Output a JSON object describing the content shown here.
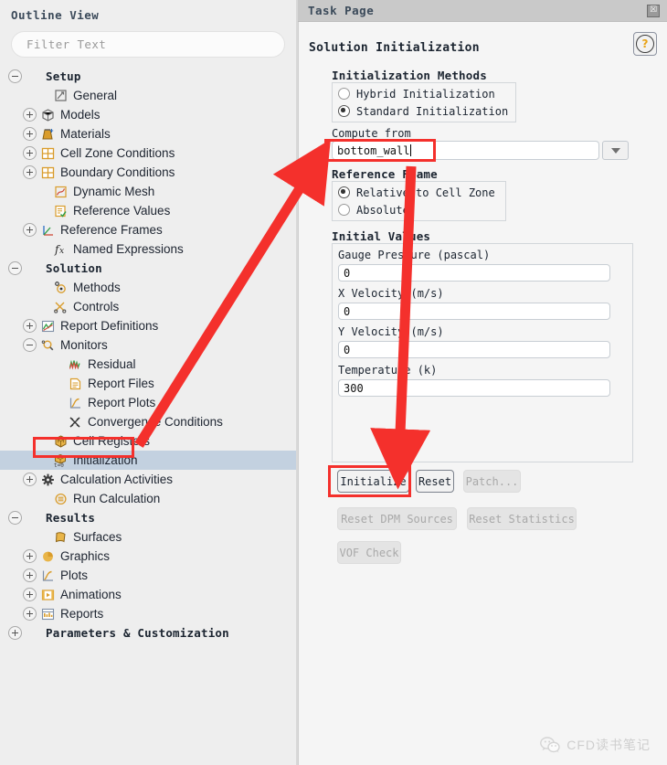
{
  "outline": {
    "title": "Outline View",
    "filter": {
      "placeholder": "Filter Text",
      "value": ""
    },
    "items": [
      {
        "label": "Setup",
        "icon": "none-icon",
        "exp": "minus",
        "level": 0,
        "group": true,
        "selected": false
      },
      {
        "label": "General",
        "icon": "general-icon",
        "exp": "none",
        "level": 2,
        "group": false,
        "selected": false
      },
      {
        "label": "Models",
        "icon": "models-cube-icon",
        "exp": "plus",
        "level": 1,
        "group": false,
        "selected": false
      },
      {
        "label": "Materials",
        "icon": "materials-flask-icon",
        "exp": "plus",
        "level": 1,
        "group": false,
        "selected": false
      },
      {
        "label": "Cell Zone Conditions",
        "icon": "grid-icon",
        "exp": "plus",
        "level": 1,
        "group": false,
        "selected": false
      },
      {
        "label": "Boundary Conditions",
        "icon": "grid-icon",
        "exp": "plus",
        "level": 1,
        "group": false,
        "selected": false
      },
      {
        "label": "Dynamic Mesh",
        "icon": "dynamic-mesh-icon",
        "exp": "none",
        "level": 2,
        "group": false,
        "selected": false
      },
      {
        "label": "Reference Values",
        "icon": "clipboard-icon",
        "exp": "none",
        "level": 2,
        "group": false,
        "selected": false
      },
      {
        "label": "Reference Frames",
        "icon": "axes-icon",
        "exp": "plus",
        "level": 1,
        "group": false,
        "selected": false
      },
      {
        "label": "Named Expressions",
        "icon": "function-icon",
        "exp": "none",
        "level": 2,
        "group": false,
        "selected": false
      },
      {
        "label": "Solution",
        "icon": "none-icon",
        "exp": "minus",
        "level": 0,
        "group": true,
        "selected": false
      },
      {
        "label": "Methods",
        "icon": "methods-icon",
        "exp": "none",
        "level": 2,
        "group": false,
        "selected": false
      },
      {
        "label": "Controls",
        "icon": "controls-scissors-icon",
        "exp": "none",
        "level": 2,
        "group": false,
        "selected": false
      },
      {
        "label": "Report Definitions",
        "icon": "report-definitions-icon",
        "exp": "plus",
        "level": 1,
        "group": false,
        "selected": false
      },
      {
        "label": "Monitors",
        "icon": "monitors-magnifier-icon",
        "exp": "minus",
        "level": 1,
        "group": false,
        "selected": false
      },
      {
        "label": "Residual",
        "icon": "residual-chart-icon",
        "exp": "none",
        "level": 3,
        "group": false,
        "selected": false
      },
      {
        "label": "Report Files",
        "icon": "report-file-icon",
        "exp": "none",
        "level": 3,
        "group": false,
        "selected": false
      },
      {
        "label": "Report Plots",
        "icon": "report-plot-icon",
        "exp": "none",
        "level": 3,
        "group": false,
        "selected": false
      },
      {
        "label": "Convergence Conditions",
        "icon": "convergence-icon",
        "exp": "none",
        "level": 3,
        "group": false,
        "selected": false
      },
      {
        "label": "Cell Registers",
        "icon": "cell-registers-icon",
        "exp": "none",
        "level": 2,
        "group": false,
        "selected": false
      },
      {
        "label": "Initialization",
        "icon": "initialization-icon",
        "exp": "none",
        "level": 2,
        "group": false,
        "selected": true
      },
      {
        "label": "Calculation Activities",
        "icon": "calculation-activities-icon",
        "exp": "plus",
        "level": 1,
        "group": false,
        "selected": false
      },
      {
        "label": "Run Calculation",
        "icon": "run-calculation-icon",
        "exp": "none",
        "level": 2,
        "group": false,
        "selected": false
      },
      {
        "label": "Results",
        "icon": "none-icon",
        "exp": "minus",
        "level": 0,
        "group": true,
        "selected": false
      },
      {
        "label": "Surfaces",
        "icon": "surfaces-icon",
        "exp": "none",
        "level": 2,
        "group": false,
        "selected": false
      },
      {
        "label": "Graphics",
        "icon": "graphics-icon",
        "exp": "plus",
        "level": 1,
        "group": false,
        "selected": false
      },
      {
        "label": "Plots",
        "icon": "plots-icon",
        "exp": "plus",
        "level": 1,
        "group": false,
        "selected": false
      },
      {
        "label": "Animations",
        "icon": "animations-icon",
        "exp": "plus",
        "level": 1,
        "group": false,
        "selected": false
      },
      {
        "label": "Reports",
        "icon": "reports-icon",
        "exp": "plus",
        "level": 1,
        "group": false,
        "selected": false
      },
      {
        "label": "Parameters & Customization",
        "icon": "none-icon",
        "exp": "plus",
        "level": 0,
        "group": true,
        "selected": false
      }
    ]
  },
  "task_page": {
    "title": "Task Page",
    "close_label": "☒",
    "panel_title": "Solution Initialization",
    "help_label": "?",
    "initialization_methods": {
      "title": "Initialization Methods",
      "options": [
        {
          "label": "Hybrid  Initialization",
          "selected": false
        },
        {
          "label": "Standard Initialization",
          "selected": true
        }
      ]
    },
    "compute_from": {
      "label": "Compute from",
      "value": "bottom_wall",
      "dropdown_icon": "chevron-down-icon"
    },
    "reference_frame": {
      "title": "Reference Frame",
      "options": [
        {
          "label": "Relative to Cell Zone",
          "selected": true
        },
        {
          "label": "Absolute",
          "selected": false
        }
      ]
    },
    "initial_values": {
      "title": "Initial Values",
      "fields": [
        {
          "label": "Gauge Pressure (pascal)",
          "value": "0"
        },
        {
          "label": "X Velocity (m/s)",
          "value": "0"
        },
        {
          "label": "Y Velocity (m/s)",
          "value": "0"
        },
        {
          "label": "Temperature (k)",
          "value": "300"
        }
      ]
    },
    "buttons": [
      {
        "label": "Initialize",
        "enabled": true
      },
      {
        "label": "Reset",
        "enabled": true
      },
      {
        "label": "Patch...",
        "enabled": false
      },
      {
        "label": "Reset DPM Sources",
        "enabled": false
      },
      {
        "label": "Reset Statistics",
        "enabled": false
      },
      {
        "label": "VOF Check",
        "enabled": false
      }
    ]
  },
  "annotations": {
    "highlight_color": "#f4302c",
    "boxes": [
      "initialization-tree-item",
      "compute-from-field",
      "initialize-button"
    ],
    "arrows": [
      "tree-to-compute-from",
      "compute-from-to-initialize"
    ]
  },
  "watermark": {
    "text": "CFD读书笔记",
    "icon": "wechat-icon"
  }
}
